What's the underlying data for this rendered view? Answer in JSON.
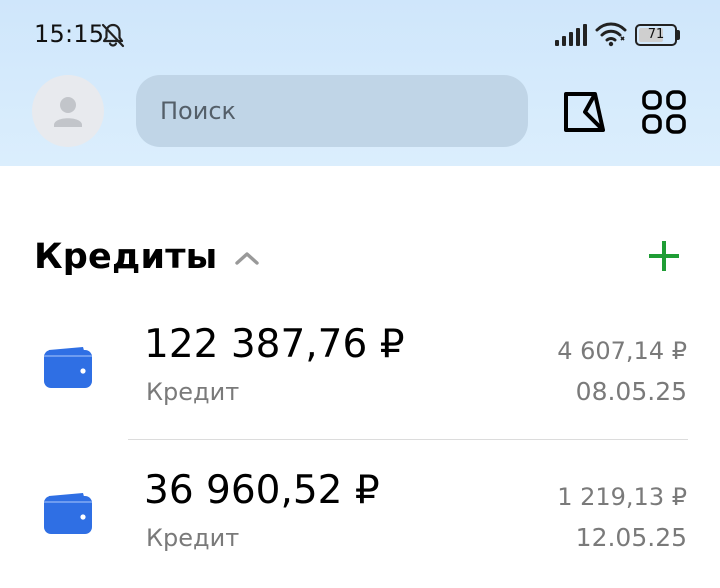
{
  "status_bar": {
    "time": "15:15",
    "battery_level": "71",
    "battery_fraction": 0.71,
    "icons": [
      "bell-off-icon",
      "signal-icon",
      "wifi-icon",
      "battery-icon"
    ]
  },
  "top_bar": {
    "avatar_icon": "person-icon",
    "search": {
      "placeholder": "Поиск",
      "value": ""
    },
    "actions": [
      "flag-icon",
      "grid-icon"
    ]
  },
  "section": {
    "title": "Кредиты",
    "collapse_icon": "chevron-up-icon",
    "add_icon": "plus-icon"
  },
  "loans": [
    {
      "amount": "122 387,76 ₽",
      "type": "Кредит",
      "payment": "4 607,14 ₽",
      "date": "08.05.25"
    },
    {
      "amount": "36 960,52 ₽",
      "type": "Кредит",
      "payment": "1 219,13 ₽",
      "date": "12.05.25"
    }
  ],
  "colors": {
    "header_background": "#d6ebfc",
    "search_background": "#bfd4e6",
    "accent_green": "#1f9d35",
    "wallet_blue": "#2f6fe4",
    "secondary_text": "#7a7a7a"
  }
}
